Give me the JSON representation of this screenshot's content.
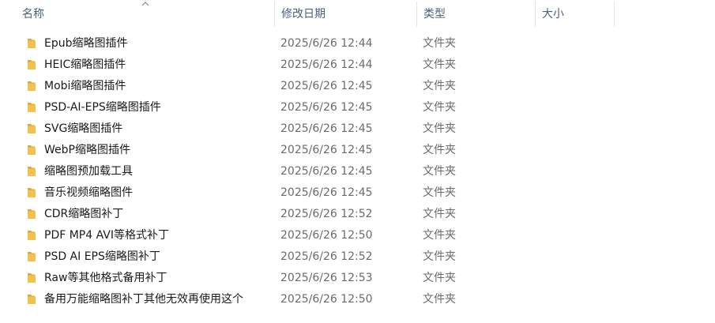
{
  "columns": {
    "name": "名称",
    "modified": "修改日期",
    "type": "类型",
    "size": "大小"
  },
  "sort": {
    "column": "name",
    "direction": "ascending"
  },
  "colors": {
    "folder": "#f2c14e",
    "folder_dark": "#e0a82e",
    "header_text": "#4c607a"
  },
  "files": [
    {
      "name": "Epub缩略图插件",
      "modified": "2025/6/26 12:44",
      "type": "文件夹",
      "size": ""
    },
    {
      "name": "HEIC缩略图插件",
      "modified": "2025/6/26 12:44",
      "type": "文件夹",
      "size": ""
    },
    {
      "name": "Mobi缩略图插件",
      "modified": "2025/6/26 12:45",
      "type": "文件夹",
      "size": ""
    },
    {
      "name": "PSD-AI-EPS缩略图插件",
      "modified": "2025/6/26 12:45",
      "type": "文件夹",
      "size": ""
    },
    {
      "name": "SVG缩略图插件",
      "modified": "2025/6/26 12:45",
      "type": "文件夹",
      "size": ""
    },
    {
      "name": "WebP缩略图插件",
      "modified": "2025/6/26 12:45",
      "type": "文件夹",
      "size": ""
    },
    {
      "name": "缩略图预加载工具",
      "modified": "2025/6/26 12:45",
      "type": "文件夹",
      "size": ""
    },
    {
      "name": "音乐视频缩略图件",
      "modified": "2025/6/26 12:45",
      "type": "文件夹",
      "size": ""
    },
    {
      "name": "CDR缩略图补丁",
      "modified": "2025/6/26 12:52",
      "type": "文件夹",
      "size": ""
    },
    {
      "name": "PDF MP4 AVI等格式补丁",
      "modified": "2025/6/26 12:50",
      "type": "文件夹",
      "size": ""
    },
    {
      "name": "PSD AI EPS缩略图补丁",
      "modified": "2025/6/26 12:52",
      "type": "文件夹",
      "size": ""
    },
    {
      "name": "Raw等其他格式备用补丁",
      "modified": "2025/6/26 12:53",
      "type": "文件夹",
      "size": ""
    },
    {
      "name": "备用万能缩略图补丁其他无效再使用这个",
      "modified": "2025/6/26 12:50",
      "type": "文件夹",
      "size": ""
    }
  ]
}
